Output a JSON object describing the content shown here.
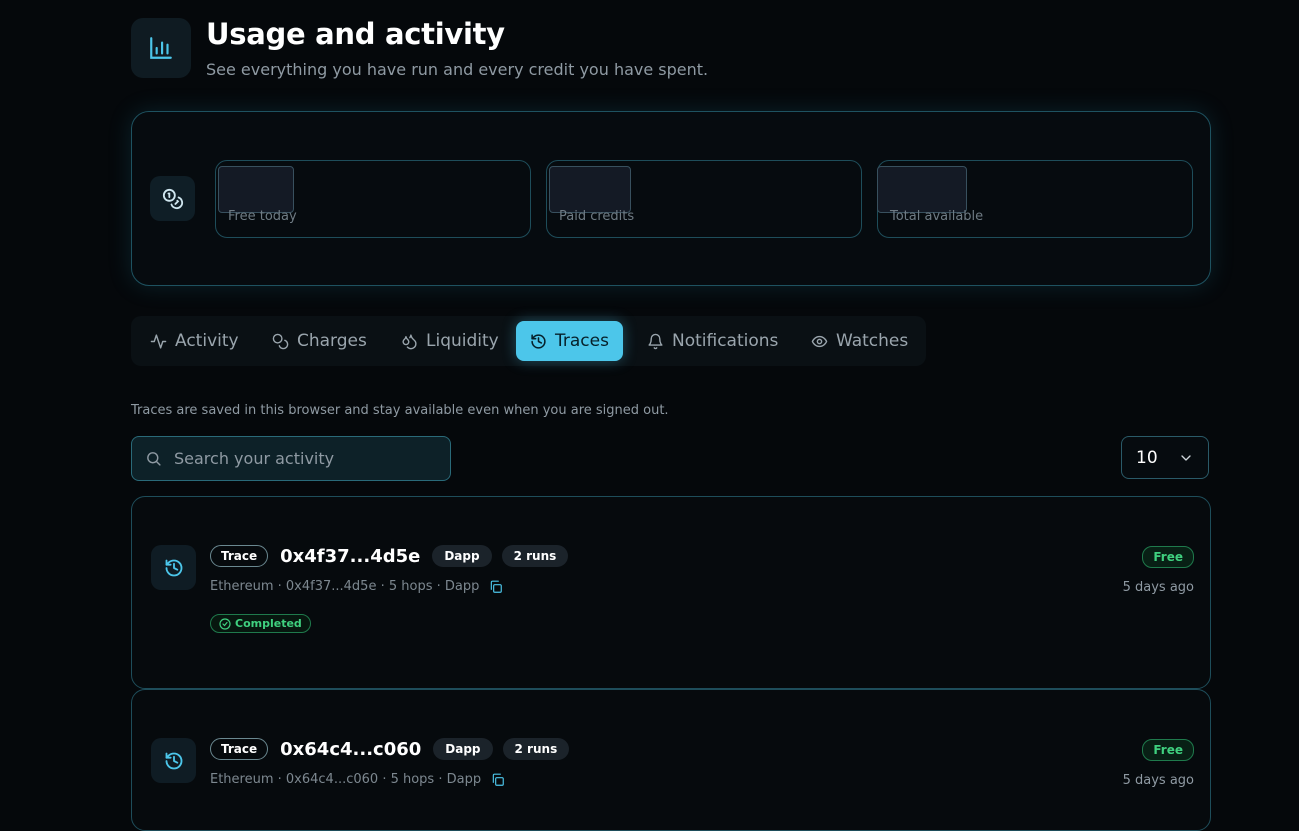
{
  "header": {
    "icon": "bar-chart-icon",
    "title": "Usage and activity",
    "subtitle": "See everything you have run and every credit you have spent."
  },
  "credits": {
    "icon": "coins-icon",
    "stats": [
      {
        "label": "Free today",
        "value": ""
      },
      {
        "label": "Paid credits",
        "value": ""
      },
      {
        "label": "Total available",
        "value": ""
      }
    ]
  },
  "tabs": [
    {
      "label": "Activity",
      "icon": "activity-icon",
      "active": false
    },
    {
      "label": "Charges",
      "icon": "coins-icon",
      "active": false
    },
    {
      "label": "Liquidity",
      "icon": "droplets-icon",
      "active": false
    },
    {
      "label": "Traces",
      "icon": "history-icon",
      "active": true
    },
    {
      "label": "Notifications",
      "icon": "bell-icon",
      "active": false
    },
    {
      "label": "Watches",
      "icon": "eye-icon",
      "active": false
    }
  ],
  "note": "Traces are saved in this browser and stay available even when you are signed out.",
  "search": {
    "placeholder": "Search your activity",
    "value": ""
  },
  "page_size": {
    "selected": "10"
  },
  "traces": [
    {
      "type_badge": "Trace",
      "hash": "0x4f37...4d5e",
      "category": "Dapp",
      "runs": "2 runs",
      "meta": "Ethereum · 0x4f37...4d5e · 5 hops · Dapp",
      "status": "Completed",
      "price": "Free",
      "time": "5 days ago"
    },
    {
      "type_badge": "Trace",
      "hash": "0x64c4...c060",
      "category": "Dapp",
      "runs": "2 runs",
      "meta": "Ethereum · 0x64c4...c060 · 5 hops · Dapp",
      "status": "",
      "price": "Free",
      "time": "5 days ago"
    }
  ],
  "colors": {
    "accent": "#4cc6ea",
    "success": "#3fd07f",
    "background": "#05080b",
    "border": "#1e4d5a"
  }
}
